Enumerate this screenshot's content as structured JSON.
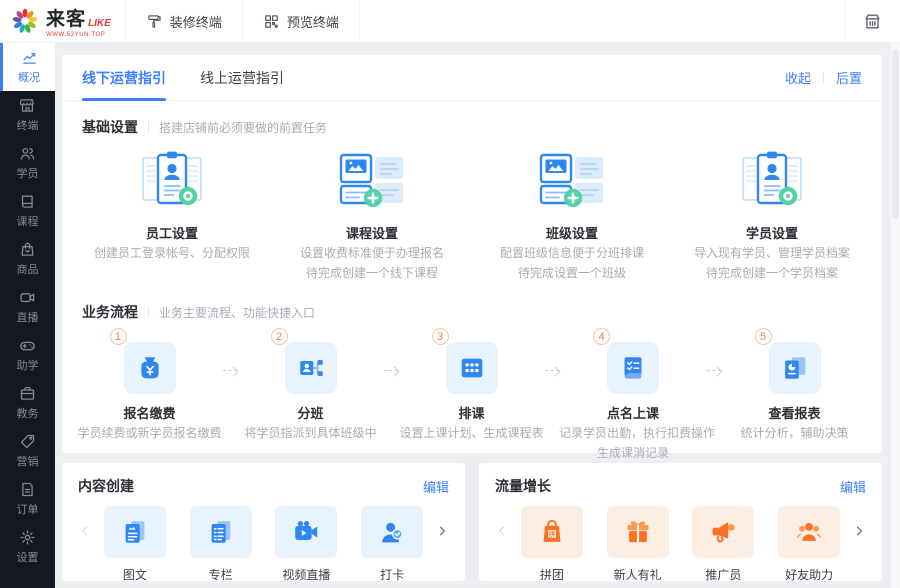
{
  "header": {
    "logo": {
      "title": "来客",
      "badge": "LIKE",
      "domain": "WWW.53YUN.TOP"
    },
    "decorate_btn": "装修终端",
    "preview_btn": "预览终端"
  },
  "sidebar": {
    "items": [
      {
        "label": "概况",
        "icon": "chart-icon",
        "active": true
      },
      {
        "label": "终端",
        "icon": "store-icon"
      },
      {
        "label": "学员",
        "icon": "students-icon"
      },
      {
        "label": "课程",
        "icon": "course-icon"
      },
      {
        "label": "商品",
        "icon": "goods-icon"
      },
      {
        "label": "直播",
        "icon": "live-icon"
      },
      {
        "label": "助学",
        "icon": "gamepad-icon"
      },
      {
        "label": "教务",
        "icon": "briefcase-icon"
      },
      {
        "label": "营销",
        "icon": "tag-icon"
      },
      {
        "label": "订单",
        "icon": "order-icon"
      },
      {
        "label": "设置",
        "icon": "gear-icon"
      }
    ]
  },
  "tabs": {
    "offline": "线下运营指引",
    "online": "线上运营指引",
    "collapse": "收起",
    "backward": "后置"
  },
  "basic": {
    "title": "基础设置",
    "subtitle": "搭建店铺前必须要做的前置任务",
    "cards": [
      {
        "title": "员工设置",
        "desc1": "创建员工登录帐号、分配权限",
        "desc2": "",
        "icon": "staff-clipboard-icon"
      },
      {
        "title": "课程设置",
        "desc1": "设置收费标准便于办理报名",
        "desc2": "待完成创建一个线下课程",
        "icon": "course-collage-icon"
      },
      {
        "title": "班级设置",
        "desc1": "配置班级信息便于分班排课",
        "desc2": "待完成设置一个班级",
        "icon": "class-collage-icon"
      },
      {
        "title": "学员设置",
        "desc1": "导入现有学员、管理学员档案",
        "desc2": "待完成创建一个学员档案",
        "icon": "student-clipboard-icon"
      }
    ]
  },
  "flow": {
    "title": "业务流程",
    "subtitle": "业务主要流程、功能快捷入口",
    "steps": [
      {
        "num": "1",
        "title": "报名缴费",
        "desc1": "学员续费或新学员报名缴费",
        "desc2": "",
        "icon": "money-bag-icon"
      },
      {
        "num": "2",
        "title": "分班",
        "desc1": "将学员指派到具体班级中",
        "desc2": "",
        "icon": "org-chart-icon"
      },
      {
        "num": "3",
        "title": "排课",
        "desc1": "设置上课计划、生成课程表",
        "desc2": "",
        "icon": "schedule-grid-icon"
      },
      {
        "num": "4",
        "title": "点名上课",
        "desc1": "记录学员出勤，执行扣费操作",
        "desc2": "生成课消记录",
        "icon": "roll-call-icon"
      },
      {
        "num": "5",
        "title": "查看报表",
        "desc1": "统计分析，辅助决策",
        "desc2": "",
        "icon": "report-icon"
      }
    ]
  },
  "content": {
    "title": "内容创建",
    "edit": "编辑",
    "items": [
      {
        "label": "图文",
        "icon": "article-icon"
      },
      {
        "label": "专栏",
        "icon": "column-icon"
      },
      {
        "label": "视频直播",
        "icon": "video-live-icon"
      },
      {
        "label": "打卡",
        "icon": "check-in-icon"
      }
    ]
  },
  "growth": {
    "title": "流量增长",
    "edit": "编辑",
    "items": [
      {
        "label": "拼团",
        "icon": "group-buy-icon"
      },
      {
        "label": "新人有礼",
        "icon": "gift-icon"
      },
      {
        "label": "推广员",
        "icon": "megaphone-icon"
      },
      {
        "label": "好友助力",
        "icon": "friends-boost-icon"
      }
    ]
  },
  "colors": {
    "accent": "#3D7FFF",
    "icon_blue": "#2F87F2",
    "tile_blue": "#E8F3FD",
    "orange": "#F97323",
    "tile_orange": "#FDEEE3",
    "green": "#53D3A5",
    "sidebar_bg": "#151820"
  }
}
